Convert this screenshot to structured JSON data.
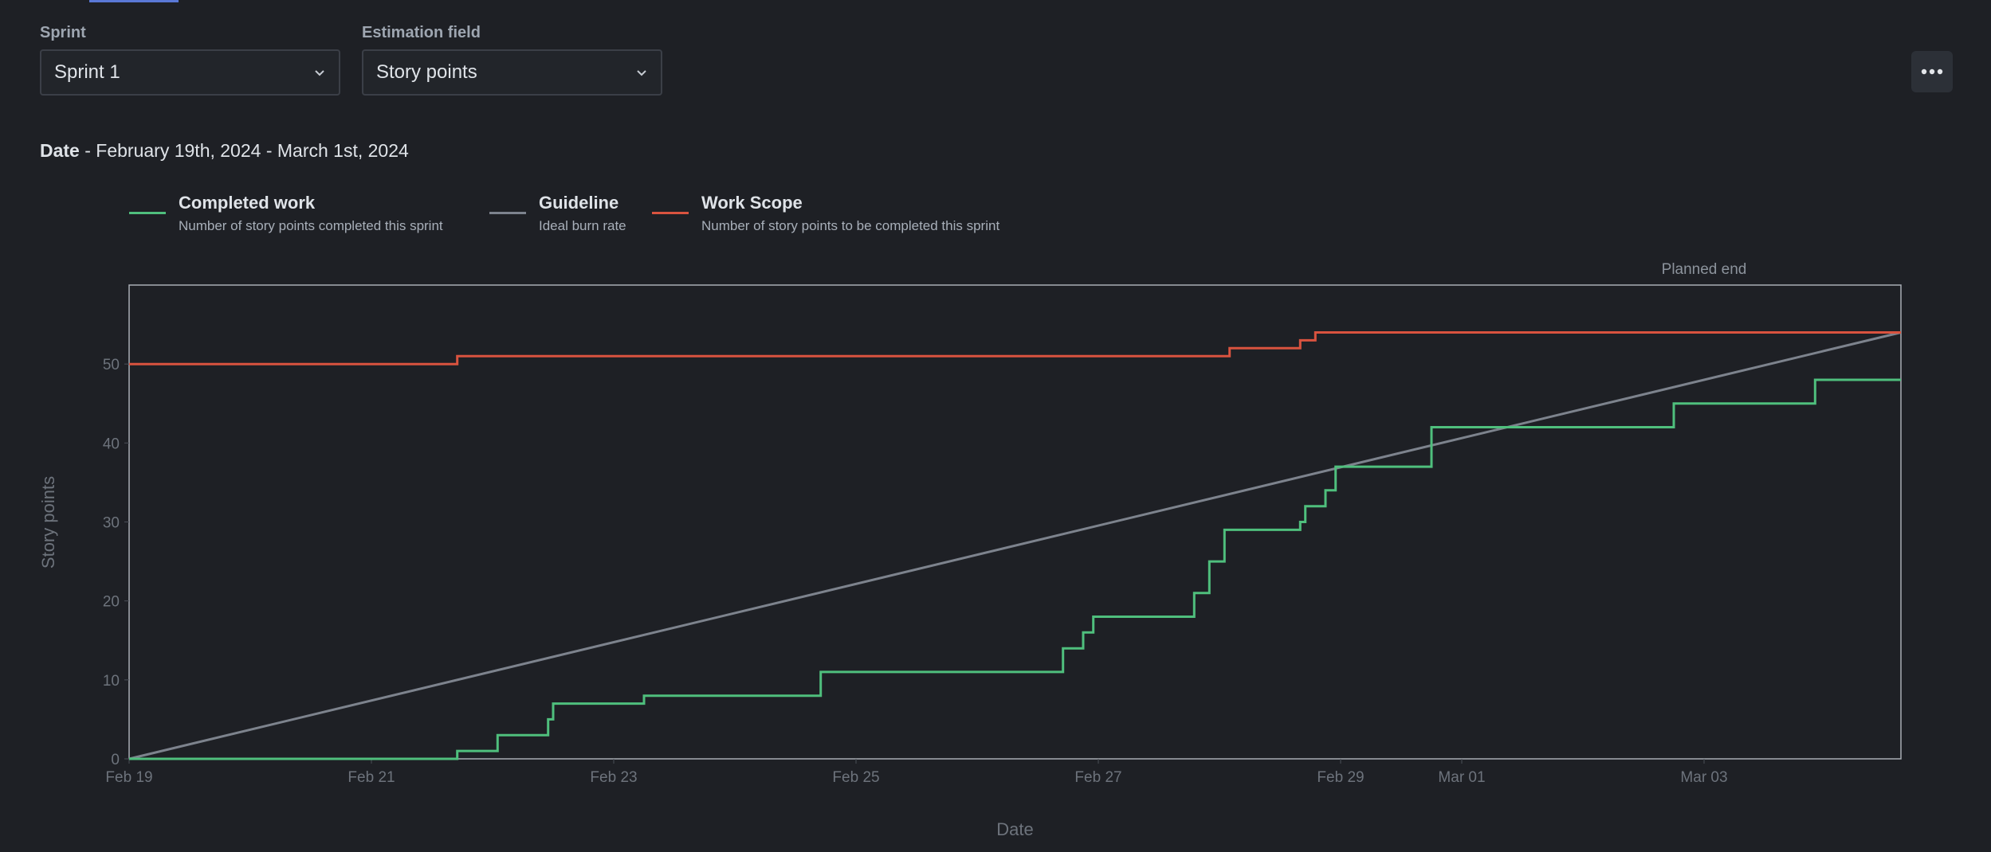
{
  "filters": {
    "sprint": {
      "label": "Sprint",
      "value": "Sprint 1"
    },
    "estimation": {
      "label": "Estimation field",
      "value": "Story points"
    }
  },
  "date_range": {
    "label": "Date",
    "text": " - February 19th, 2024 - March 1st, 2024"
  },
  "colors": {
    "completed": "#4fbf7d",
    "guideline": "#7d838d",
    "scope": "#d9533f",
    "background": "#1e2025"
  },
  "legend": [
    {
      "name": "Completed work",
      "description": "Number of story points completed this sprint"
    },
    {
      "name": "Guideline",
      "description": "Ideal burn rate"
    },
    {
      "name": "Work Scope",
      "description": "Number of story points to be completed this sprint"
    }
  ],
  "chart_data": {
    "type": "line",
    "xlabel": "Date",
    "ylabel": "Story points",
    "x_range": [
      "2024-02-19",
      "2024-03-04 15:00"
    ],
    "ylim": [
      0,
      60
    ],
    "x_ticks": [
      {
        "date": "2024-02-19",
        "label": "Feb 19"
      },
      {
        "date": "2024-02-21",
        "label": "Feb 21"
      },
      {
        "date": "2024-02-23",
        "label": "Feb 23"
      },
      {
        "date": "2024-02-25",
        "label": "Feb 25"
      },
      {
        "date": "2024-02-27",
        "label": "Feb 27"
      },
      {
        "date": "2024-02-29",
        "label": "Feb 29"
      },
      {
        "date": "2024-03-01",
        "label": "Mar 01"
      },
      {
        "date": "2024-03-03",
        "label": "Mar 03"
      }
    ],
    "y_ticks": [
      0,
      10,
      20,
      30,
      40,
      50
    ],
    "annotations": [
      {
        "date": "2024-03-03 00:00",
        "label": "Planned end"
      }
    ],
    "grid": false,
    "legend_position": "top-left",
    "series": [
      {
        "name": "Completed work",
        "step": true,
        "points": [
          [
            "2024-02-19 00:00",
            0
          ],
          [
            "2024-02-21 17:00",
            0
          ],
          [
            "2024-02-21 17:00",
            1
          ],
          [
            "2024-02-22 01:00",
            1
          ],
          [
            "2024-02-22 01:00",
            3
          ],
          [
            "2024-02-22 11:00",
            3
          ],
          [
            "2024-02-22 11:00",
            5
          ],
          [
            "2024-02-22 12:00",
            5
          ],
          [
            "2024-02-22 12:00",
            7
          ],
          [
            "2024-02-23 06:00",
            7
          ],
          [
            "2024-02-23 06:00",
            8
          ],
          [
            "2024-02-24 17:00",
            8
          ],
          [
            "2024-02-24 17:00",
            11
          ],
          [
            "2024-02-26 17:00",
            11
          ],
          [
            "2024-02-26 17:00",
            14
          ],
          [
            "2024-02-26 21:00",
            14
          ],
          [
            "2024-02-26 21:00",
            16
          ],
          [
            "2024-02-26 23:00",
            16
          ],
          [
            "2024-02-26 23:00",
            18
          ],
          [
            "2024-02-27 19:00",
            18
          ],
          [
            "2024-02-27 19:00",
            21
          ],
          [
            "2024-02-27 22:00",
            21
          ],
          [
            "2024-02-27 22:00",
            25
          ],
          [
            "2024-02-28 01:00",
            25
          ],
          [
            "2024-02-28 01:00",
            29
          ],
          [
            "2024-02-28 16:00",
            29
          ],
          [
            "2024-02-28 16:00",
            30
          ],
          [
            "2024-02-28 17:00",
            30
          ],
          [
            "2024-02-28 17:00",
            32
          ],
          [
            "2024-02-28 21:00",
            32
          ],
          [
            "2024-02-28 21:00",
            34
          ],
          [
            "2024-02-28 23:00",
            34
          ],
          [
            "2024-02-28 23:00",
            37
          ],
          [
            "2024-02-29 18:00",
            37
          ],
          [
            "2024-02-29 18:00",
            42
          ],
          [
            "2024-03-02 18:00",
            42
          ],
          [
            "2024-03-02 18:00",
            45
          ],
          [
            "2024-03-03 22:00",
            45
          ],
          [
            "2024-03-03 22:00",
            48
          ],
          [
            "2024-03-04 15:00",
            48
          ]
        ]
      },
      {
        "name": "Guideline",
        "points": [
          [
            "2024-02-19 00:00",
            0
          ],
          [
            "2024-03-04 15:00",
            54
          ]
        ]
      },
      {
        "name": "Work Scope",
        "step": true,
        "points": [
          [
            "2024-02-19 00:00",
            50
          ],
          [
            "2024-02-21 17:00",
            50
          ],
          [
            "2024-02-21 17:00",
            51
          ],
          [
            "2024-02-28 02:00",
            51
          ],
          [
            "2024-02-28 02:00",
            52
          ],
          [
            "2024-02-28 16:00",
            52
          ],
          [
            "2024-02-28 16:00",
            53
          ],
          [
            "2024-02-28 19:00",
            53
          ],
          [
            "2024-02-28 19:00",
            54
          ],
          [
            "2024-03-04 15:00",
            54
          ]
        ]
      }
    ]
  }
}
